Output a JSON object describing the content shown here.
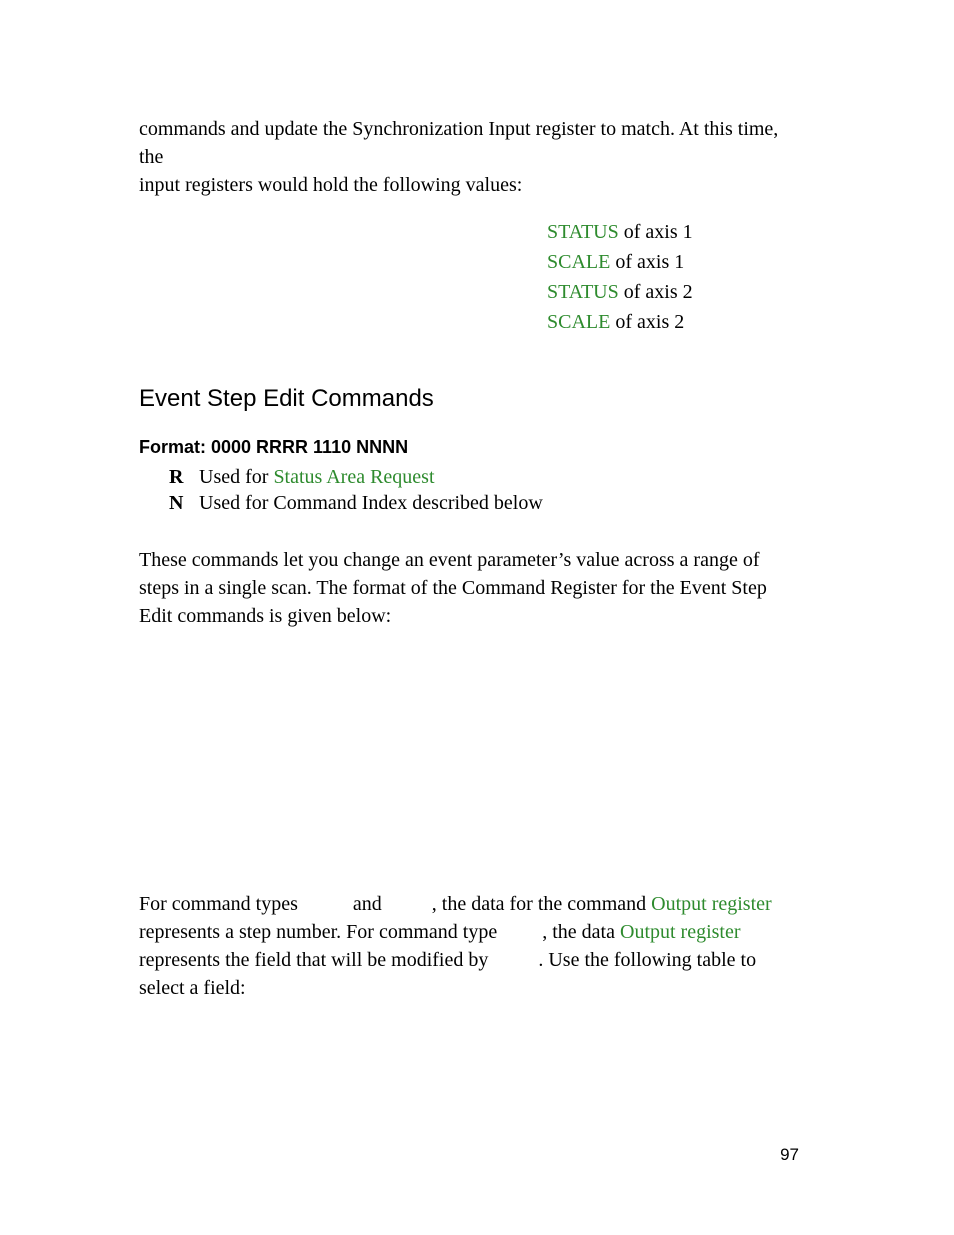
{
  "intro_line1": "commands and update the Synchronization Input register to match.  At this time, the",
  "intro_line2": "input registers would hold the following values:",
  "reg_rows": [
    {
      "link": "STATUS",
      "rest": " of axis 1"
    },
    {
      "link": "SCALE",
      "rest": " of axis 1"
    },
    {
      "link": "STATUS",
      "rest": " of axis 2"
    },
    {
      "link": "SCALE",
      "rest": " of axis 2"
    }
  ],
  "heading": "Event Step Edit Commands",
  "format_heading": "Format: 0000 RRRR 1110 NNNN",
  "defs": {
    "r_letter": "R",
    "r_pre": "Used for ",
    "r_link": "Status Area Request",
    "n_letter": "N",
    "n_text": "Used for Command Index described below"
  },
  "para1": "These commands let you change an event parameter’s value across a range of steps in a single scan.  The format of the Command Register for the Event Step Edit commands is given below:",
  "para2": {
    "t1": "For command types ",
    "gap1": "          ",
    "t2": "and",
    "gap2": "          ",
    "t3": ", the data for the command ",
    "link1": "Output register",
    "t4": " represents a step number.  For command type ",
    "gap3": "        ",
    "t5": ", the data ",
    "link2": "Output register",
    "t6": " represents the field that will be modified by ",
    "gap4": "         ",
    "t7": ".  Use the following table to select a field:"
  },
  "page_number": "97"
}
